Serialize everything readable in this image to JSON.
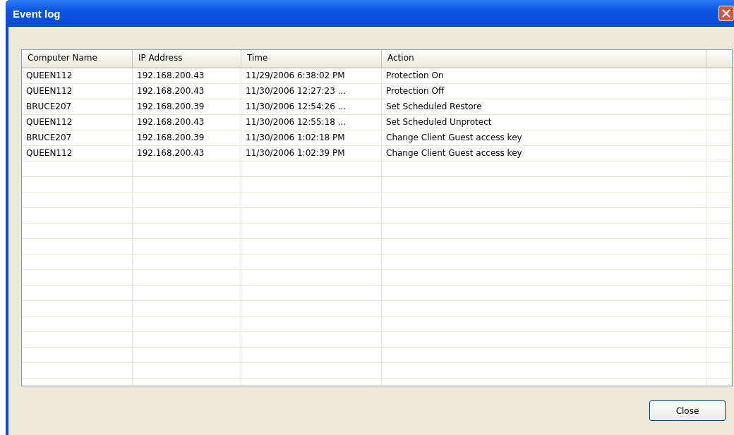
{
  "window": {
    "title": "Event log"
  },
  "table": {
    "columns": [
      "Computer Name",
      "IP Address",
      "Time",
      "Action"
    ],
    "rows": [
      {
        "cells": [
          "QUEEN112",
          "192.168.200.43",
          "11/29/2006 6:38:02 PM",
          "Protection On"
        ]
      },
      {
        "cells": [
          "QUEEN112",
          "192.168.200.43",
          "11/30/2006 12:27:23 ...",
          "Protection Off"
        ]
      },
      {
        "cells": [
          "BRUCE207",
          "192.168.200.39",
          "11/30/2006 12:54:26 ...",
          "Set Scheduled Restore"
        ]
      },
      {
        "cells": [
          "QUEEN112",
          "192.168.200.43",
          "11/30/2006 12:55:18 ...",
          "Set Scheduled Unprotect"
        ]
      },
      {
        "cells": [
          "BRUCE207",
          "192.168.200.39",
          "11/30/2006 1:02:18 PM",
          "Change Client Guest access key"
        ]
      },
      {
        "cells": [
          "QUEEN112",
          "192.168.200.43",
          "11/30/2006 1:02:39 PM",
          "Change Client Guest access key"
        ]
      }
    ]
  },
  "buttons": [
    "Close"
  ]
}
